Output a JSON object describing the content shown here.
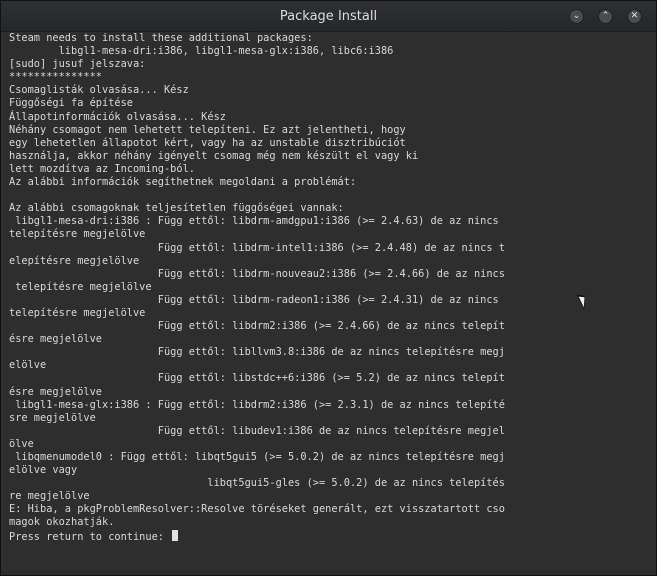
{
  "window": {
    "title": "Package Install",
    "buttons": {
      "minimize": "⌄",
      "maximize": "⌃",
      "close": "✕"
    }
  },
  "terminal": {
    "lines": [
      "Steam needs to install these additional packages:",
      "        libgl1-mesa-dri:i386, libgl1-mesa-glx:i386, libc6:i386",
      "[sudo] jusuf jelszava:",
      "***************",
      "Csomaglisták olvasása... Kész",
      "Függőségi fa építése",
      "Állapotinformációk olvasása... Kész",
      "Néhány csomagot nem lehetett telepíteni. Ez azt jelentheti, hogy",
      "egy lehetetlen állapotot kért, vagy ha az unstable disztribúciót",
      "használja, akkor néhány igényelt csomag még nem készült el vagy ki",
      "lett mozdítva az Incoming-ból.",
      "Az alábbi információk segíthetnek megoldani a problémát:",
      "",
      "Az alábbi csomagoknak teljesítetlen függőségei vannak:",
      " libgl1-mesa-dri:i386 : Függ ettől: libdrm-amdgpu1:i386 (>= 2.4.63) de az nincs",
      "telepítésre megjelölve",
      "                        Függ ettől: libdrm-intel1:i386 (>= 2.4.48) de az nincs t",
      "elepítésre megjelölve",
      "                        Függ ettől: libdrm-nouveau2:i386 (>= 2.4.66) de az nincs",
      " telepítésre megjelölve",
      "                        Függ ettől: libdrm-radeon1:i386 (>= 2.4.31) de az nincs",
      "telepítésre megjelölve",
      "                        Függ ettől: libdrm2:i386 (>= 2.4.66) de az nincs telepít",
      "ésre megjelölve",
      "                        Függ ettől: libllvm3.8:i386 de az nincs telepítésre megj",
      "elölve",
      "                        Függ ettől: libstdc++6:i386 (>= 5.2) de az nincs telepít",
      "ésre megjelölve",
      " libgl1-mesa-glx:i386 : Függ ettől: libdrm2:i386 (>= 2.3.1) de az nincs telepíté",
      "sre megjelölve",
      "                        Függ ettől: libudev1:i386 de az nincs telepítésre megjel",
      "ölve",
      " libqmenumodel0 : Függ ettől: libqt5gui5 (>= 5.0.2) de az nincs telepítésre megj",
      "elölve vagy",
      "                                libqt5gui5-gles (>= 5.0.2) de az nincs telepítés",
      "re megjelölve",
      "E: Hiba, a pkgProblemResolver::Resolve töréseket generált, ezt visszatartott cso",
      "magok okozhatják.",
      "Press return to continue: "
    ]
  }
}
